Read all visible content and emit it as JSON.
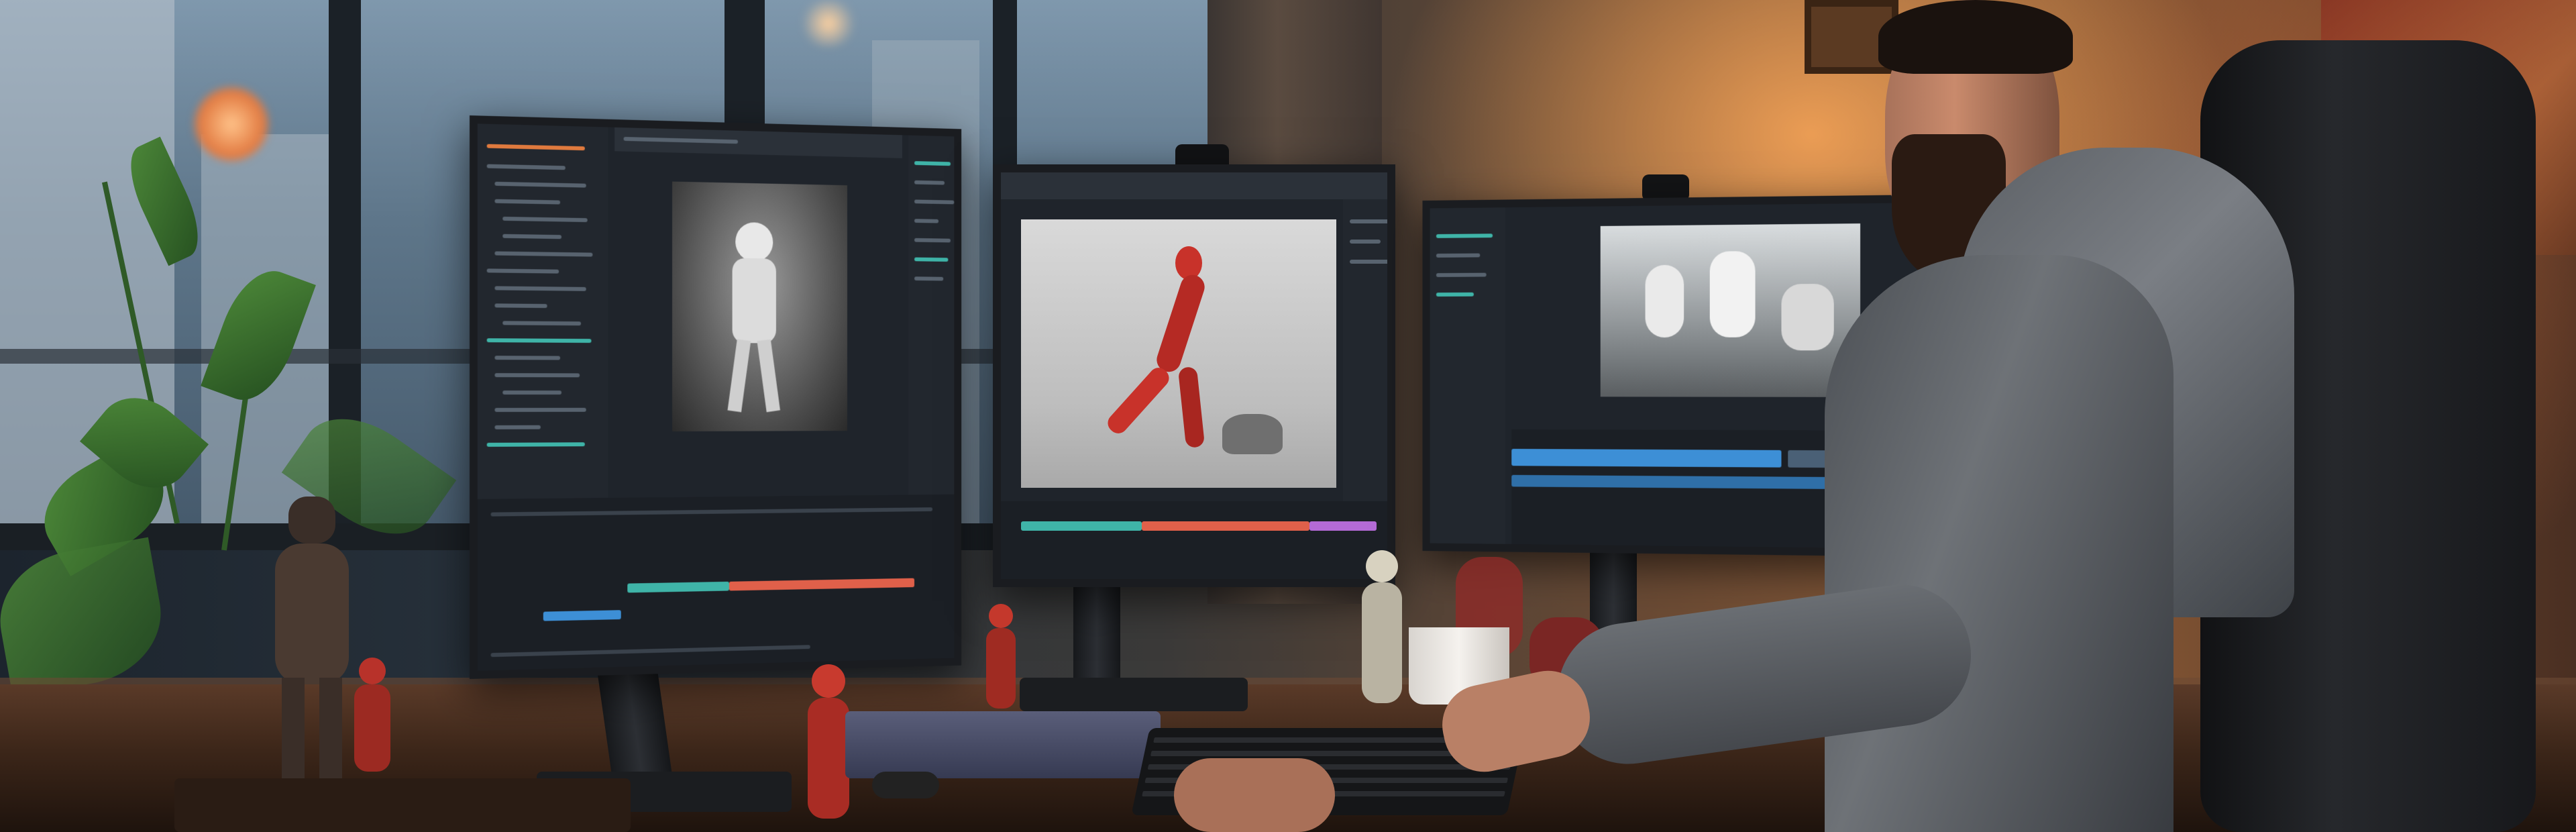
{
  "scene": {
    "description_free": true,
    "palette": {
      "warm_lamp": "#ffaa5a",
      "cool_window": "#7f98ad",
      "figure_red": "#c8322a",
      "ui_teal": "#3fb4a8",
      "ui_orange": "#e07a3e",
      "ui_blue": "#3d8fd6"
    },
    "icons": [
      "monitor",
      "figurine",
      "keyboard",
      "mug",
      "plant",
      "office-chair",
      "webcam"
    ]
  }
}
